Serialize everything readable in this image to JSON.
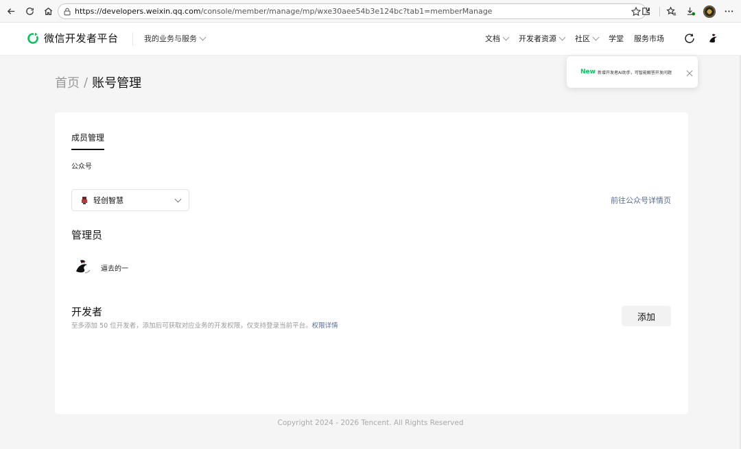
{
  "browser": {
    "url_host": "https://developers.weixin.qq.com",
    "url_path": "/console/member/manage/mp/wxe30aee54b3e124bc?tab1=memberManage"
  },
  "header": {
    "logo_text": "微信开发者平台",
    "biz_menu": "我的业务与服务",
    "nav": {
      "docs": "文档",
      "dev_resources": "开发者资源",
      "community": "社区",
      "academy": "学堂",
      "market": "服务市场"
    }
  },
  "breadcrumb": {
    "home": "首页",
    "separator": "/",
    "current": "账号管理"
  },
  "toast": {
    "badge": "New",
    "text": "新增开发者AI助手，可智能解答开发问题"
  },
  "main": {
    "tab": "成员管理",
    "account_type_label": "公众号",
    "account_select": "轻创智慧",
    "detail_link": "前往公众号详情页",
    "admin_heading": "管理员",
    "admin_name": "逼去的一",
    "dev_heading": "开发者",
    "dev_desc": "至多添加 50 位开发者，添加后可获取对应业务的开发权限，仅支持登录当前平台。",
    "dev_desc_link": "权限详情",
    "add_button": "添加"
  },
  "footer": {
    "copyright": "Copyright 2024 - 2026 Tencent. All Rights Reserved"
  },
  "colors": {
    "brand_green": "#07c160",
    "link_blue": "#576b95"
  }
}
